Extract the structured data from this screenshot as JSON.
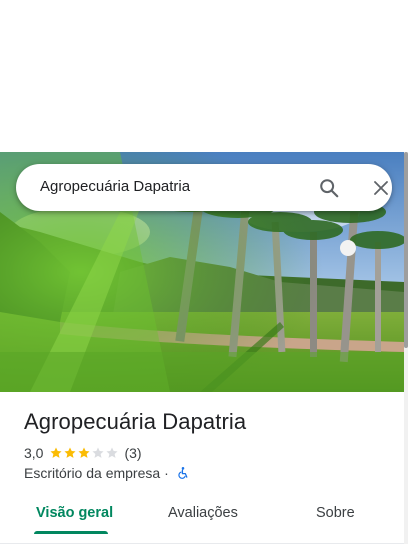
{
  "search": {
    "query": "Agropecuária Dapatria",
    "search_icon": "search-icon",
    "close_icon": "close-icon"
  },
  "place": {
    "name": "Agropecuária Dapatria",
    "rating": "3,0",
    "stars_filled": 3,
    "stars_total": 5,
    "review_count": "(3)",
    "category": "Escritório da empresa",
    "separator": "·",
    "accessibility_icon": "wheelchair-icon"
  },
  "tabs": [
    {
      "label": "Visão geral",
      "active": true
    },
    {
      "label": "Avaliações",
      "active": false
    },
    {
      "label": "Sobre",
      "active": false
    }
  ],
  "colors": {
    "accent": "#01875f",
    "star": "#fbbc04",
    "star_empty": "#dadce0",
    "wheelchair": "#1a73e8"
  }
}
